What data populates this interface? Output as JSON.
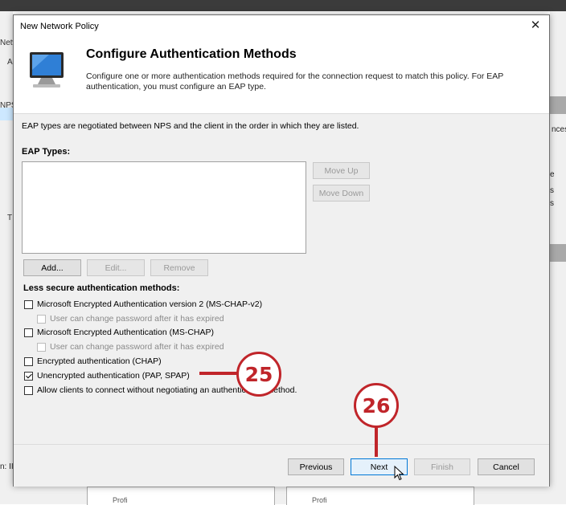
{
  "background": {
    "left_fragments": [
      "Netw",
      "A",
      "NPS",
      "T"
    ],
    "right_fragments": [
      "nces",
      "e",
      "s",
      "s"
    ],
    "bottom_fragments": [
      "n: II",
      "Profi",
      "Profi"
    ]
  },
  "dialog": {
    "title": "New Network Policy",
    "close_glyph": "✕",
    "header": {
      "heading": "Configure Authentication Methods",
      "description": "Configure one or more authentication methods required for the connection request to match this policy. For EAP authentication, you must configure an EAP type."
    },
    "note": "EAP types are negotiated between NPS and the client in the order in which they are listed.",
    "eap_types": {
      "label": "EAP Types:",
      "items": [],
      "move_up_label": "Move Up",
      "move_down_label": "Move Down",
      "add_label": "Add...",
      "edit_label": "Edit...",
      "remove_label": "Remove"
    },
    "less_secure": {
      "label": "Less secure authentication methods:",
      "mschapv2": {
        "label": "Microsoft Encrypted Authentication version 2 (MS-CHAP-v2)",
        "checked": false
      },
      "mschapv2_change": {
        "label": "User can change password after it has expired",
        "checked": false,
        "enabled": false
      },
      "mschap": {
        "label": "Microsoft Encrypted Authentication (MS-CHAP)",
        "checked": false
      },
      "mschap_change": {
        "label": "User can change password after it has expired",
        "checked": false,
        "enabled": false
      },
      "chap": {
        "label": "Encrypted authentication (CHAP)",
        "checked": false
      },
      "pap": {
        "label": "Unencrypted authentication (PAP, SPAP)",
        "checked": true
      },
      "no_negotiation": {
        "label": "Allow clients to connect without negotiating an authentication method.",
        "checked": false
      }
    },
    "footer": {
      "previous_label": "Previous",
      "next_label": "Next",
      "finish_label": "Finish",
      "cancel_label": "Cancel"
    }
  },
  "callouts": {
    "step_a": "25",
    "step_b": "26"
  },
  "colors": {
    "callout": "#c0252a",
    "focus": "#0078d7",
    "dialog_bg": "#f0f0f0"
  }
}
